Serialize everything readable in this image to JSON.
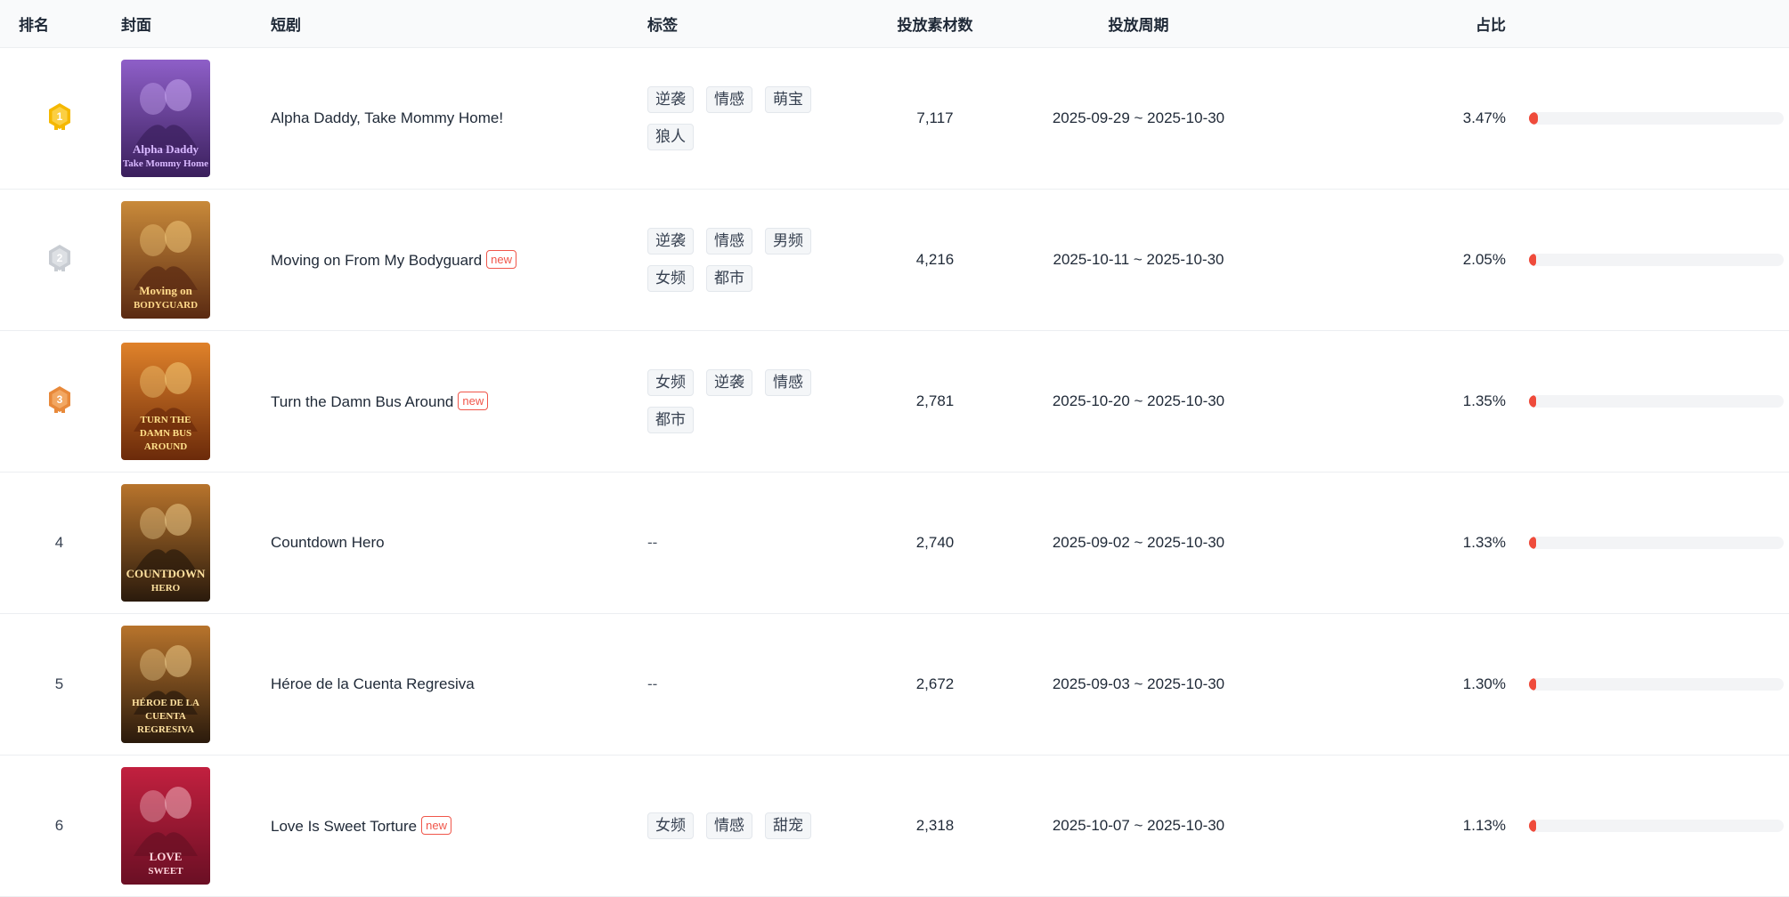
{
  "headers": {
    "rank": "排名",
    "cover": "封面",
    "title": "短剧",
    "tags": "标签",
    "count": "投放素材数",
    "period": "投放周期",
    "share": "占比"
  },
  "empty_tags": "--",
  "colors": {
    "accent": "#ef4b3b",
    "new_badge": "#f0564a",
    "gold": "#f5b800",
    "silver": "#c8ccd2",
    "bronze": "#e8893a"
  },
  "rows": [
    {
      "rank": "1",
      "medal": "gold-medal-icon",
      "title": "Alpha Daddy, Take Mommy Home!",
      "is_new": false,
      "new_label": "",
      "tags": [
        "逆袭",
        "情感",
        "萌宝",
        "狼人"
      ],
      "count": "7,117",
      "period": "2025-09-29 ~ 2025-10-30",
      "share": "3.47%",
      "share_value": 3.47,
      "cover_text": [
        "Alpha Daddy",
        "Take Mommy Home"
      ]
    },
    {
      "rank": "2",
      "medal": "silver-medal-icon",
      "title": "Moving on From My Bodyguard",
      "is_new": true,
      "new_label": "new",
      "tags": [
        "逆袭",
        "情感",
        "男频",
        "女频",
        "都市"
      ],
      "count": "4,216",
      "period": "2025-10-11 ~ 2025-10-30",
      "share": "2.05%",
      "share_value": 2.05,
      "cover_text": [
        "Moving on",
        "BODYGUARD"
      ]
    },
    {
      "rank": "3",
      "medal": "bronze-medal-icon",
      "title": "Turn the Damn Bus Around",
      "is_new": true,
      "new_label": "new",
      "tags": [
        "女频",
        "逆袭",
        "情感",
        "都市"
      ],
      "count": "2,781",
      "period": "2025-10-20 ~ 2025-10-30",
      "share": "1.35%",
      "share_value": 1.35,
      "cover_text": [
        "TURN THE",
        "DAMN BUS",
        "AROUND"
      ]
    },
    {
      "rank": "4",
      "medal": "",
      "title": "Countdown Hero",
      "is_new": false,
      "new_label": "",
      "tags": [],
      "count": "2,740",
      "period": "2025-09-02 ~ 2025-10-30",
      "share": "1.33%",
      "share_value": 1.33,
      "cover_text": [
        "COUNTDOWN",
        "HERO"
      ]
    },
    {
      "rank": "5",
      "medal": "",
      "title": "Héroe de la Cuenta Regresiva",
      "is_new": false,
      "new_label": "",
      "tags": [],
      "count": "2,672",
      "period": "2025-09-03 ~ 2025-10-30",
      "share": "1.30%",
      "share_value": 1.3,
      "cover_text": [
        "HÉROE DE LA",
        "CUENTA",
        "REGRESIVA"
      ]
    },
    {
      "rank": "6",
      "medal": "",
      "title": "Love Is Sweet Torture",
      "is_new": true,
      "new_label": "new",
      "tags": [
        "女频",
        "情感",
        "甜宠"
      ],
      "count": "2,318",
      "period": "2025-10-07 ~ 2025-10-30",
      "share": "1.13%",
      "share_value": 1.13,
      "cover_text": [
        "LOVE",
        "SWEET"
      ]
    }
  ]
}
